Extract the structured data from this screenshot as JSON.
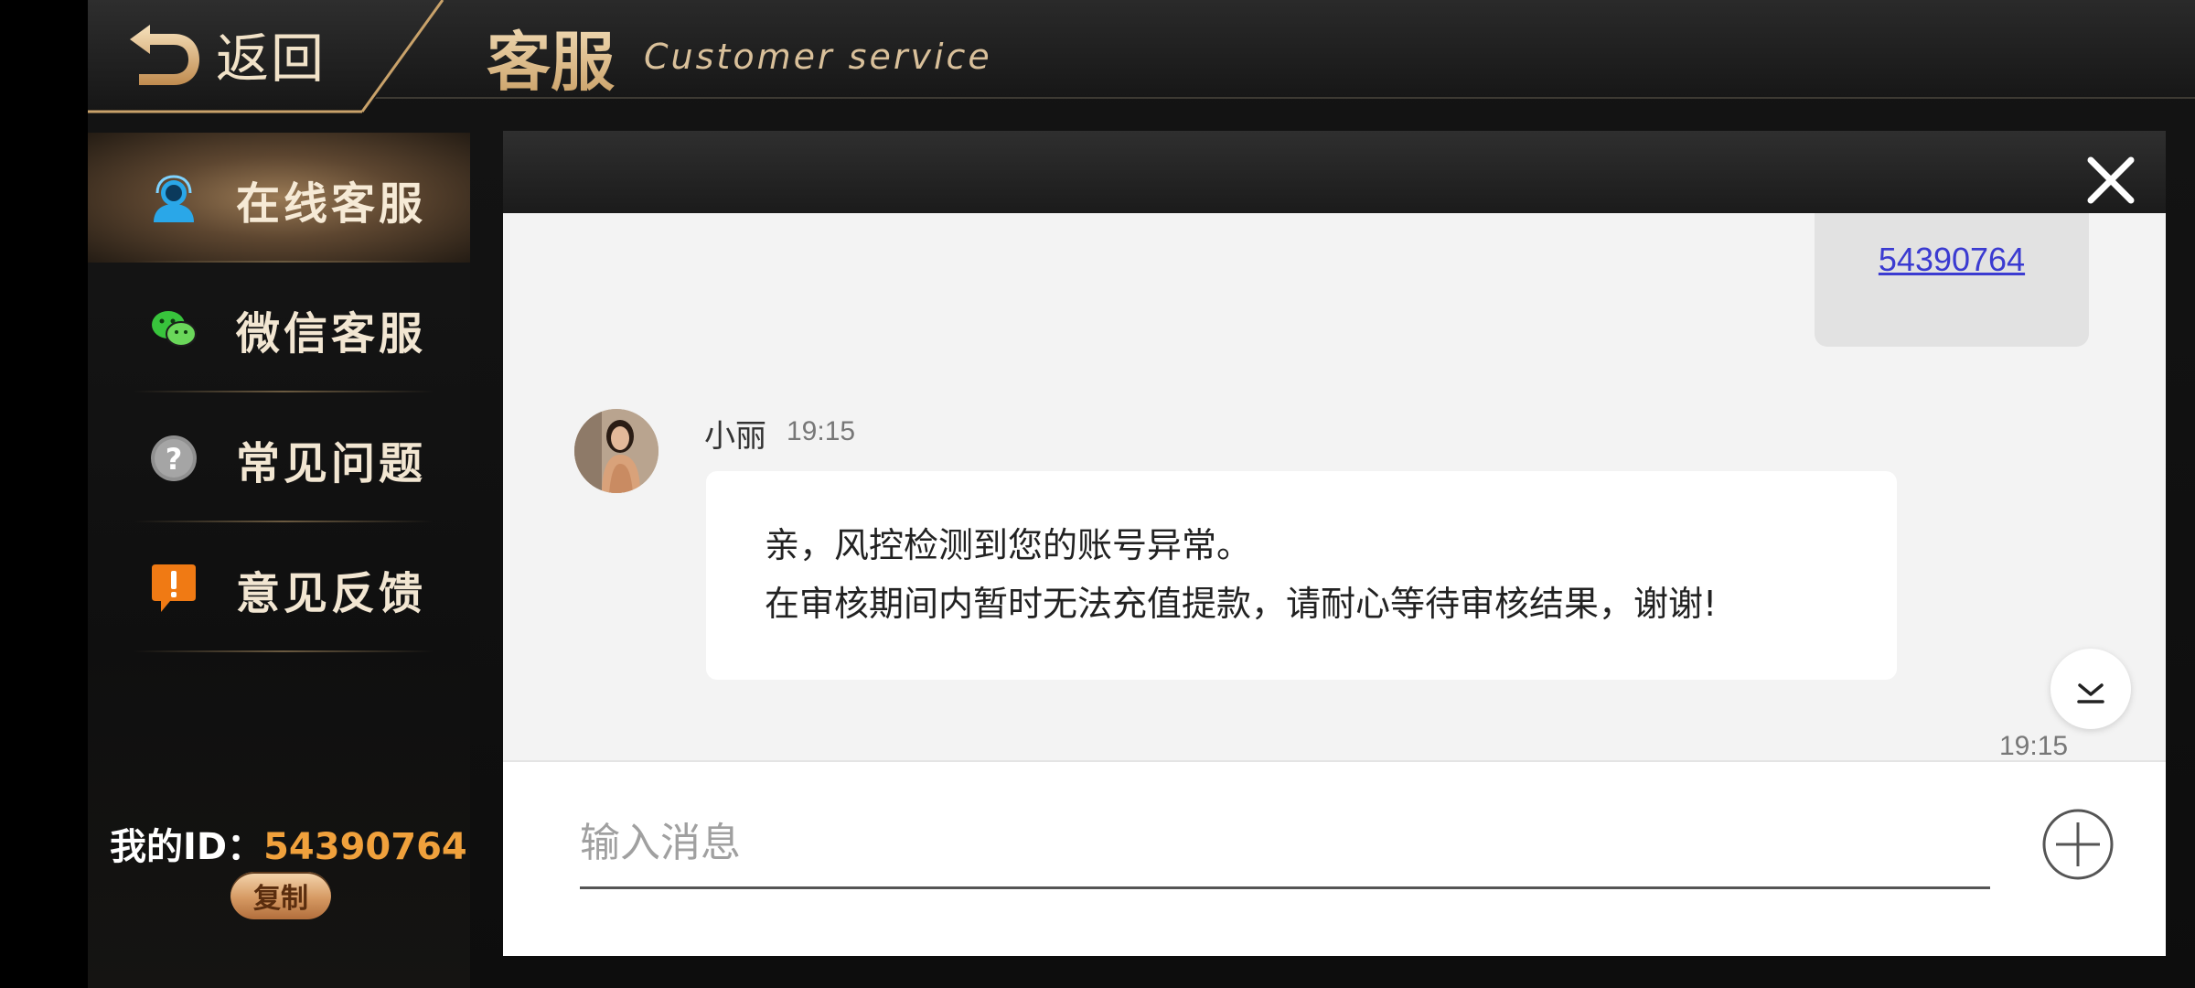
{
  "header": {
    "back_label": "返回",
    "title_cn": "客服",
    "title_en": "Customer service"
  },
  "sidebar": {
    "items": [
      {
        "label": "在线客服",
        "icon": "agent-headset-icon",
        "active": true
      },
      {
        "label": "微信客服",
        "icon": "wechat-icon",
        "active": false
      },
      {
        "label": "常见问题",
        "icon": "question-icon",
        "active": false
      },
      {
        "label": "意见反馈",
        "icon": "feedback-alert-icon",
        "active": false
      }
    ],
    "my_id_label": "我的ID：",
    "my_id_value": "54390764",
    "copy_label": "复制"
  },
  "chat": {
    "sent_message": "54390764",
    "agent": {
      "name": "小丽",
      "time": "19:15"
    },
    "message_lines": [
      "亲，风控检测到您的账号异常。",
      "在审核期间内暂时无法充值提款，请耐心等待审核结果，谢谢!"
    ],
    "bottom_time": "19:15",
    "input_placeholder": "输入消息"
  },
  "colors": {
    "accent_gold": "#e8cfa2",
    "id_orange": "#f0a13c",
    "link_blue": "#3b3bd1"
  }
}
